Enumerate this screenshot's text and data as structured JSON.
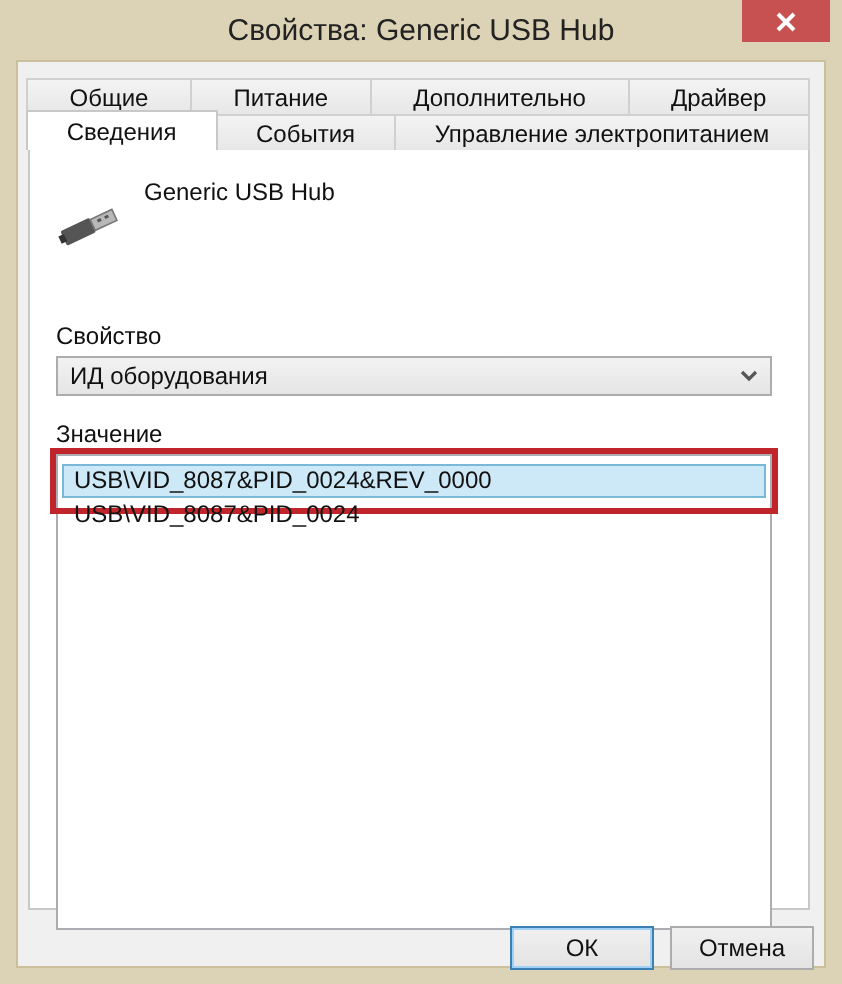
{
  "window": {
    "title": "Свойства: Generic USB Hub"
  },
  "tab_rows": [
    [
      {
        "label": "Общие",
        "selected": false
      },
      {
        "label": "Питание",
        "selected": false
      },
      {
        "label": "Дополнительно",
        "selected": false
      },
      {
        "label": "Драйвер",
        "selected": false
      }
    ],
    [
      {
        "label": "Сведения",
        "selected": true
      },
      {
        "label": "События",
        "selected": false
      },
      {
        "label": "Управление электропитанием",
        "selected": false
      }
    ]
  ],
  "device": {
    "name": "Generic USB Hub"
  },
  "property": {
    "label": "Свойство",
    "value": "ИД оборудования"
  },
  "value_list": {
    "label": "Значение",
    "items": [
      {
        "text": "USB\\VID_8087&PID_0024&REV_0000",
        "selected": true,
        "highlighted": true
      },
      {
        "text": "USB\\VID_8087&PID_0024",
        "selected": false,
        "highlighted": false
      }
    ]
  },
  "buttons": [
    {
      "label": "ОК",
      "default": true
    },
    {
      "label": "Отмена",
      "default": false
    }
  ]
}
